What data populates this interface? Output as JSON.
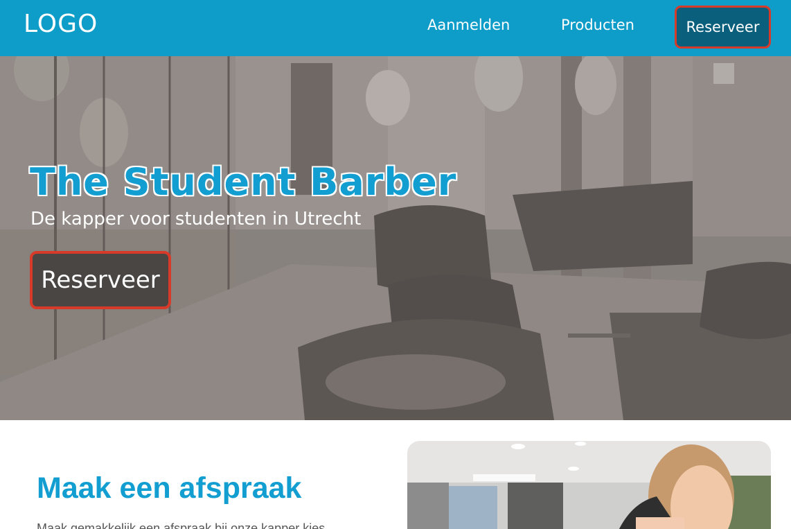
{
  "nav": {
    "logo": "LOGO",
    "links": [
      {
        "label": "Aanmelden"
      },
      {
        "label": "Producten"
      }
    ],
    "cta_label": "Reserveer"
  },
  "hero": {
    "title": "The Student Barber",
    "subtitle": "De kapper voor studenten in Utrecht",
    "button_label": "Reserveer"
  },
  "section": {
    "heading": "Maak een afspraak",
    "text": "Maak gemakkelijk een afspraak bij onze kapper kies"
  },
  "colors": {
    "brand_blue": "#0e9cc9",
    "accent_red": "#d83a2a",
    "dark_teal": "#0a5f7d",
    "hero_gray": "#8f8a86"
  }
}
